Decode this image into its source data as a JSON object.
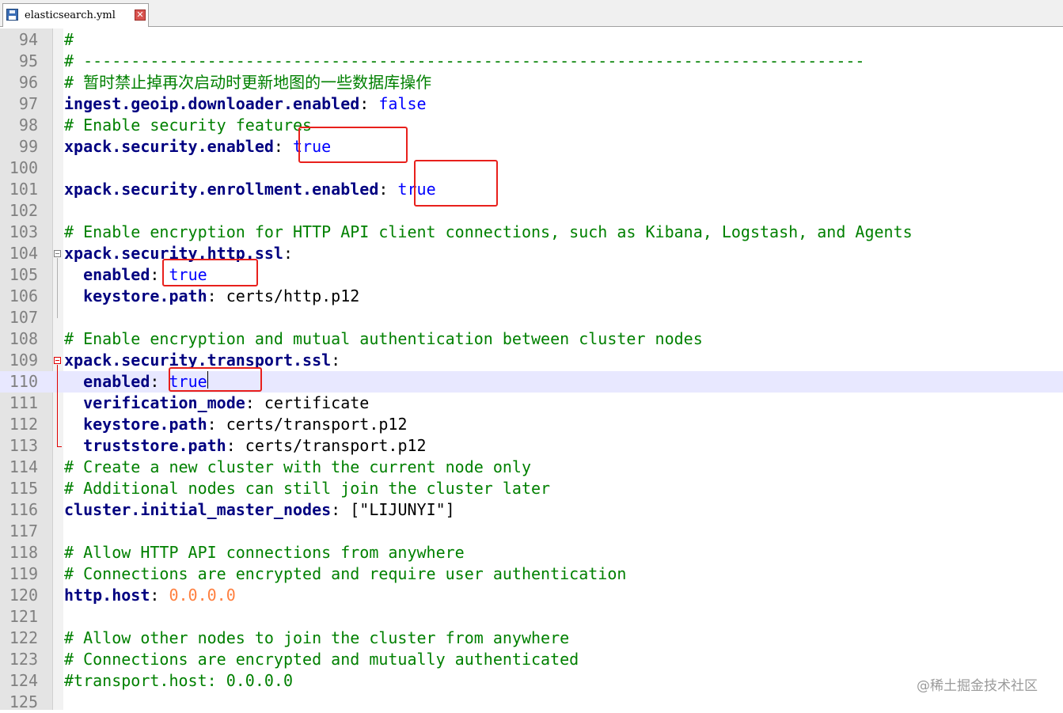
{
  "tab": {
    "title": "elasticsearch.yml",
    "close_glyph": "✕"
  },
  "editor": {
    "current_line": 110,
    "lines": [
      {
        "num": "94",
        "segs": [
          {
            "t": "#",
            "c": "comment"
          }
        ]
      },
      {
        "num": "95",
        "segs": [
          {
            "t": "# ----------------------------------------------------------------------------------",
            "c": "comment"
          }
        ]
      },
      {
        "num": "96",
        "segs": [
          {
            "t": "# 暂时禁止掉再次启动时更新地图的一些数据库操作",
            "c": "comment"
          }
        ]
      },
      {
        "num": "97",
        "segs": [
          {
            "t": "ingest.geoip.downloader.enabled",
            "c": "key"
          },
          {
            "t": ": ",
            "c": "text"
          },
          {
            "t": "false",
            "c": "bool"
          }
        ]
      },
      {
        "num": "98",
        "segs": [
          {
            "t": "# Enable security features",
            "c": "comment"
          }
        ]
      },
      {
        "num": "99",
        "segs": [
          {
            "t": "xpack.security.enabled",
            "c": "key"
          },
          {
            "t": ": ",
            "c": "text"
          },
          {
            "t": "true",
            "c": "bool"
          }
        ]
      },
      {
        "num": "100",
        "segs": []
      },
      {
        "num": "101",
        "segs": [
          {
            "t": "xpack.security.enrollment.enabled",
            "c": "key"
          },
          {
            "t": ": ",
            "c": "text"
          },
          {
            "t": "true",
            "c": "bool"
          }
        ]
      },
      {
        "num": "102",
        "segs": []
      },
      {
        "num": "103",
        "segs": [
          {
            "t": "# Enable encryption for HTTP API client connections, such as Kibana, Logstash, and Agents",
            "c": "comment"
          }
        ]
      },
      {
        "num": "104",
        "segs": [
          {
            "t": "xpack.security.http.ssl",
            "c": "key"
          },
          {
            "t": ":",
            "c": "text"
          }
        ]
      },
      {
        "num": "105",
        "segs": [
          {
            "t": "  ",
            "c": "text"
          },
          {
            "t": "enabled",
            "c": "key"
          },
          {
            "t": ": ",
            "c": "text"
          },
          {
            "t": "true",
            "c": "bool"
          }
        ]
      },
      {
        "num": "106",
        "segs": [
          {
            "t": "  ",
            "c": "text"
          },
          {
            "t": "keystore.path",
            "c": "key"
          },
          {
            "t": ": certs/http.p12",
            "c": "text"
          }
        ]
      },
      {
        "num": "107",
        "segs": []
      },
      {
        "num": "108",
        "segs": [
          {
            "t": "# Enable encryption and mutual authentication between cluster nodes",
            "c": "comment"
          }
        ]
      },
      {
        "num": "109",
        "segs": [
          {
            "t": "xpack.security.transport.ssl",
            "c": "key"
          },
          {
            "t": ":",
            "c": "text"
          }
        ]
      },
      {
        "num": "110",
        "segs": [
          {
            "t": "  ",
            "c": "text"
          },
          {
            "t": "enabled",
            "c": "key"
          },
          {
            "t": ": ",
            "c": "text"
          },
          {
            "t": "true",
            "c": "bool"
          }
        ]
      },
      {
        "num": "111",
        "segs": [
          {
            "t": "  ",
            "c": "text"
          },
          {
            "t": "verification_mode",
            "c": "key"
          },
          {
            "t": ": certificate",
            "c": "text"
          }
        ]
      },
      {
        "num": "112",
        "segs": [
          {
            "t": "  ",
            "c": "text"
          },
          {
            "t": "keystore.path",
            "c": "key"
          },
          {
            "t": ": certs/transport.p12",
            "c": "text"
          }
        ]
      },
      {
        "num": "113",
        "segs": [
          {
            "t": "  ",
            "c": "text"
          },
          {
            "t": "truststore.path",
            "c": "key"
          },
          {
            "t": ": certs/transport.p12",
            "c": "text"
          }
        ]
      },
      {
        "num": "114",
        "segs": [
          {
            "t": "# Create a new cluster with the current node only",
            "c": "comment"
          }
        ]
      },
      {
        "num": "115",
        "segs": [
          {
            "t": "# Additional nodes can still join the cluster later",
            "c": "comment"
          }
        ]
      },
      {
        "num": "116",
        "segs": [
          {
            "t": "cluster.initial_master_nodes",
            "c": "key"
          },
          {
            "t": ": [\"LIJUNYI\"]",
            "c": "text"
          }
        ]
      },
      {
        "num": "117",
        "segs": []
      },
      {
        "num": "118",
        "segs": [
          {
            "t": "# Allow HTTP API connections from anywhere",
            "c": "comment"
          }
        ]
      },
      {
        "num": "119",
        "segs": [
          {
            "t": "# Connections are encrypted and require user authentication",
            "c": "comment"
          }
        ]
      },
      {
        "num": "120",
        "segs": [
          {
            "t": "http.host",
            "c": "key"
          },
          {
            "t": ": ",
            "c": "text"
          },
          {
            "t": "0.0.0.0",
            "c": "num"
          }
        ]
      },
      {
        "num": "121",
        "segs": []
      },
      {
        "num": "122",
        "segs": [
          {
            "t": "# Allow other nodes to join the cluster from anywhere",
            "c": "comment"
          }
        ]
      },
      {
        "num": "123",
        "segs": [
          {
            "t": "# Connections are encrypted and mutually authenticated",
            "c": "comment"
          }
        ]
      },
      {
        "num": "124",
        "segs": [
          {
            "t": "#transport.host: 0.0.0.0",
            "c": "comment"
          }
        ]
      },
      {
        "num": "125",
        "segs": []
      }
    ]
  },
  "annotations": {
    "highlighted_values": [
      "line-99-value",
      "line-101-value",
      "line-105-value",
      "line-110-value"
    ],
    "highlight_color": "#e8201c"
  },
  "watermark": "@稀土掘金技术社区",
  "colors": {
    "comment": "#008000",
    "key": "#000080",
    "bool": "#0000ff",
    "number": "#ff8040",
    "current_line": "#e8e8ff"
  }
}
